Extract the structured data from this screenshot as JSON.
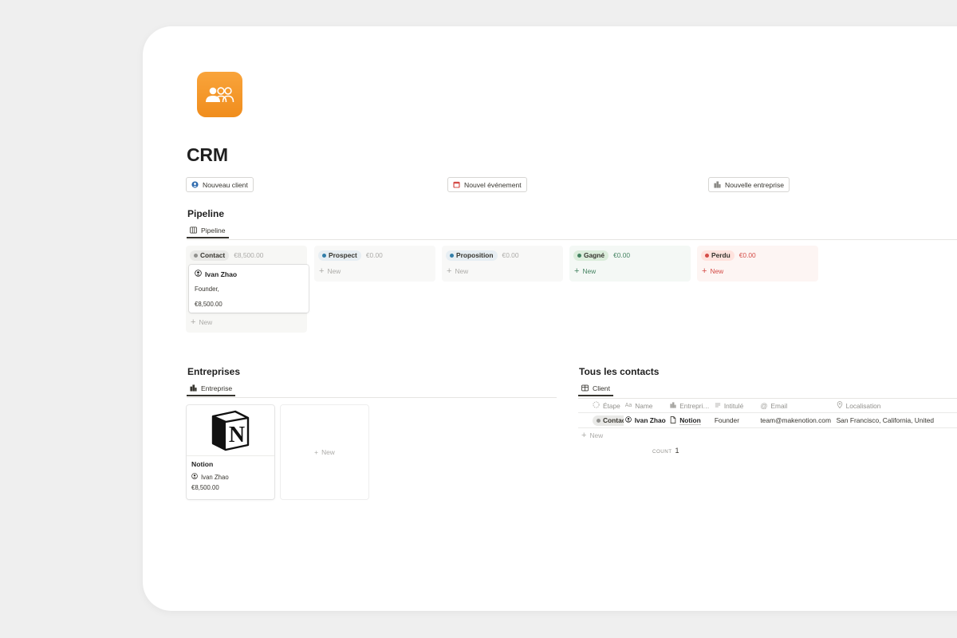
{
  "page": {
    "title": "CRM"
  },
  "buttons": [
    {
      "label": "Nouveau client",
      "icon": "person-circle-icon",
      "color": "#2f6bae"
    },
    {
      "label": "Nouvel événement",
      "icon": "calendar-icon",
      "color": "#d44c47"
    },
    {
      "label": "Nouvelle entreprise",
      "icon": "building-icon",
      "color": "#8b8a86"
    }
  ],
  "pipeline": {
    "title": "Pipeline",
    "view_tab": "Pipeline",
    "columns": [
      {
        "label": "Contact",
        "sum": "€8,500.00",
        "dot": "#91918e",
        "pill_bg": "#e9e9e7",
        "col_bg": "#f7f7f5",
        "sum_color": "#acaba8",
        "new_color": "#acaba8"
      },
      {
        "label": "Prospect",
        "sum": "€0.00",
        "dot": "#337ea9",
        "pill_bg": "#e7eef3",
        "col_bg": "#f8f8f7",
        "sum_color": "#acaba8",
        "new_color": "#acaba8"
      },
      {
        "label": "Proposition",
        "sum": "€0.00",
        "dot": "#337ea9",
        "pill_bg": "#e7eef3",
        "col_bg": "#f8f8f7",
        "sum_color": "#acaba8",
        "new_color": "#acaba8"
      },
      {
        "label": "Gagné",
        "sum": "€0.00",
        "dot": "#448361",
        "pill_bg": "#dbeddb",
        "col_bg": "#f4f8f5",
        "sum_color": "#448361",
        "new_color": "#448361"
      },
      {
        "label": "Perdu",
        "sum": "€0.00",
        "dot": "#d44c47",
        "pill_bg": "#ffe2dd",
        "col_bg": "#fdf5f3",
        "sum_color": "#d44c47",
        "new_color": "#d44c47"
      }
    ],
    "new_label": "New",
    "card": {
      "name": "Ivan Zhao",
      "title": "Founder,",
      "amount": "€8,500.00"
    }
  },
  "entreprises": {
    "title": "Entreprises",
    "view_tab": "Entreprise",
    "card": {
      "name": "Notion",
      "owner": "Ivan Zhao",
      "amount": "€8,500.00"
    },
    "new_label": "New"
  },
  "contacts": {
    "title": "Tous les contacts",
    "view_tab": "Client",
    "columns": [
      {
        "label": "Étape",
        "icon": "status-icon"
      },
      {
        "label": "Name",
        "icon": "text-icon"
      },
      {
        "label": "Entrepri…",
        "icon": "building-icon"
      },
      {
        "label": "Intitulé",
        "icon": "list-icon"
      },
      {
        "label": "Email",
        "icon": "at-icon"
      },
      {
        "label": "Localisation",
        "icon": "location-pin-icon"
      }
    ],
    "rows": [
      {
        "etape": "Contact",
        "name": "Ivan Zhao",
        "entreprise": "Notion",
        "intitule": "Founder",
        "email": "team@makenotion.com",
        "localisation": "San Francisco, California, United"
      }
    ],
    "new_label": "New",
    "count_label": "COUNT",
    "count_value": "1"
  }
}
